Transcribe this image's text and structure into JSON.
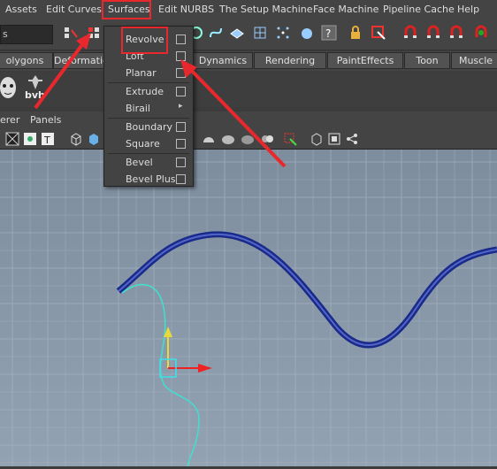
{
  "menubar": {
    "items": [
      "Assets",
      "Edit Curves",
      "Surfaces",
      "Edit NURBS",
      "The Setup Machine",
      "Face Machine",
      "Pipeline Cache",
      "Help"
    ]
  },
  "statusline": {
    "selection_mode": "s"
  },
  "shelf_tabs": [
    "olygons",
    "Deformatio",
    "Dynamics",
    "Rendering",
    "PaintEffects",
    "Toon",
    "Muscle"
  ],
  "shelf": {
    "bvh_label": "bvh"
  },
  "panel_menu": {
    "items": [
      "erer",
      "Panels"
    ]
  },
  "surfaces_menu": {
    "items": [
      {
        "label": "Revolve"
      },
      {
        "label": "Loft"
      },
      {
        "label": "Planar"
      },
      {
        "label": "Extrude"
      },
      {
        "label": "Birail"
      },
      {
        "label": "Boundary"
      },
      {
        "label": "Square"
      },
      {
        "label": "Bevel"
      },
      {
        "label": "Bevel Plus"
      }
    ]
  },
  "colors": {
    "highlight": "#e8282c",
    "curve_blue": "#1a2a8a",
    "profile_curve": "#3ee0d0"
  }
}
